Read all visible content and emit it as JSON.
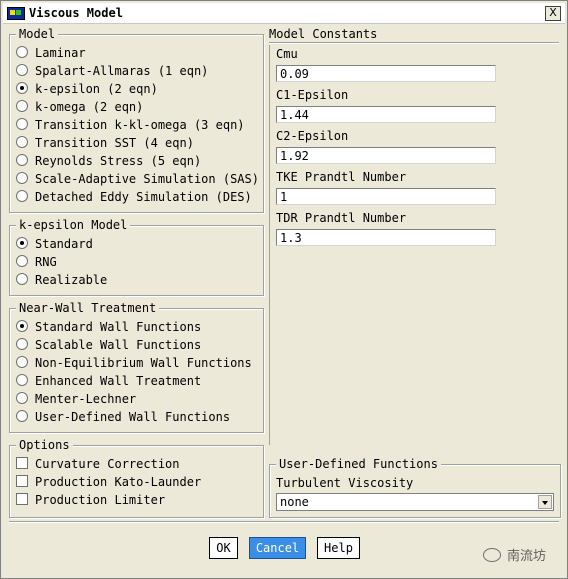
{
  "window": {
    "title": "Viscous Model",
    "close_glyph": "X"
  },
  "model": {
    "legend": "Model",
    "options": [
      {
        "label": "Laminar",
        "selected": false
      },
      {
        "label": "Spalart-Allmaras (1 eqn)",
        "selected": false
      },
      {
        "label": "k-epsilon (2 eqn)",
        "selected": true
      },
      {
        "label": "k-omega (2 eqn)",
        "selected": false
      },
      {
        "label": "Transition k-kl-omega (3 eqn)",
        "selected": false
      },
      {
        "label": "Transition SST (4 eqn)",
        "selected": false
      },
      {
        "label": "Reynolds Stress (5 eqn)",
        "selected": false
      },
      {
        "label": "Scale-Adaptive Simulation (SAS)",
        "selected": false
      },
      {
        "label": "Detached Eddy Simulation (DES)",
        "selected": false
      }
    ]
  },
  "kepsilon": {
    "legend": "k-epsilon Model",
    "options": [
      {
        "label": "Standard",
        "selected": true
      },
      {
        "label": "RNG",
        "selected": false
      },
      {
        "label": "Realizable",
        "selected": false
      }
    ]
  },
  "nearwall": {
    "legend": "Near-Wall Treatment",
    "options": [
      {
        "label": "Standard Wall Functions",
        "selected": true
      },
      {
        "label": "Scalable Wall Functions",
        "selected": false
      },
      {
        "label": "Non-Equilibrium Wall Functions",
        "selected": false
      },
      {
        "label": "Enhanced Wall Treatment",
        "selected": false
      },
      {
        "label": "Menter-Lechner",
        "selected": false
      },
      {
        "label": "User-Defined Wall Functions",
        "selected": false
      }
    ]
  },
  "options": {
    "legend": "Options",
    "checks": [
      {
        "label": "Curvature Correction",
        "checked": false
      },
      {
        "label": "Production Kato-Launder",
        "checked": false
      },
      {
        "label": "Production Limiter",
        "checked": false
      }
    ]
  },
  "constants": {
    "title": "Model Constants",
    "items": [
      {
        "label": "Cmu",
        "value": "0.09"
      },
      {
        "label": "C1-Epsilon",
        "value": "1.44"
      },
      {
        "label": "C2-Epsilon",
        "value": "1.92"
      },
      {
        "label": "TKE Prandtl Number",
        "value": "1"
      },
      {
        "label": "TDR Prandtl Number",
        "value": "1.3"
      }
    ]
  },
  "udf": {
    "legend": "User-Defined Functions",
    "label": "Turbulent Viscosity",
    "selected": "none"
  },
  "buttons": {
    "ok": "OK",
    "cancel": "Cancel",
    "help": "Help"
  },
  "watermark": {
    "text": "南流坊"
  }
}
